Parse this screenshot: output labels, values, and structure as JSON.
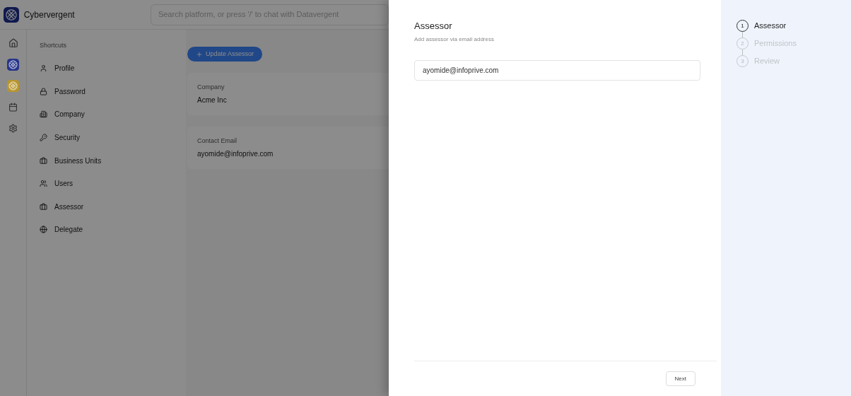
{
  "app": {
    "brand": "Cybervergent",
    "search": {
      "placeholder": "Search platform, or press '/' to chat with Datavergent"
    }
  },
  "rail": [
    {
      "kind": "home"
    },
    {
      "kind": "logo",
      "color": "#27358a"
    },
    {
      "kind": "logo",
      "color": "#b8962e"
    },
    {
      "kind": "calendar"
    },
    {
      "kind": "settings"
    }
  ],
  "shortcuts": {
    "title": "Shortcuts",
    "items": [
      {
        "label": "Profile",
        "kind": "user"
      },
      {
        "label": "Password",
        "kind": "lock"
      },
      {
        "label": "Company",
        "kind": "building"
      },
      {
        "label": "Security",
        "kind": "key"
      },
      {
        "label": "Business Units",
        "kind": "briefcase"
      },
      {
        "label": "Users",
        "kind": "users"
      },
      {
        "label": "Assessor",
        "kind": "briefcase"
      },
      {
        "label": "Delegate",
        "kind": "globe"
      }
    ]
  },
  "main": {
    "button": "Update Assessor",
    "cards": [
      {
        "label": "Company",
        "value": "Acme Inc"
      },
      {
        "label": "Contact Email",
        "value": "ayomide@infoprive.com"
      }
    ]
  },
  "drawer": {
    "title": "Assessor",
    "subtitle": "Add assessor via email address",
    "email": {
      "value": "ayomide@infoprive.com"
    },
    "next": "Next",
    "steps": [
      {
        "number": "1",
        "label": "Assessor",
        "selected": true
      },
      {
        "number": "2",
        "label": "Permissions",
        "selected": false
      },
      {
        "number": "3",
        "label": "Review",
        "selected": false
      }
    ]
  }
}
